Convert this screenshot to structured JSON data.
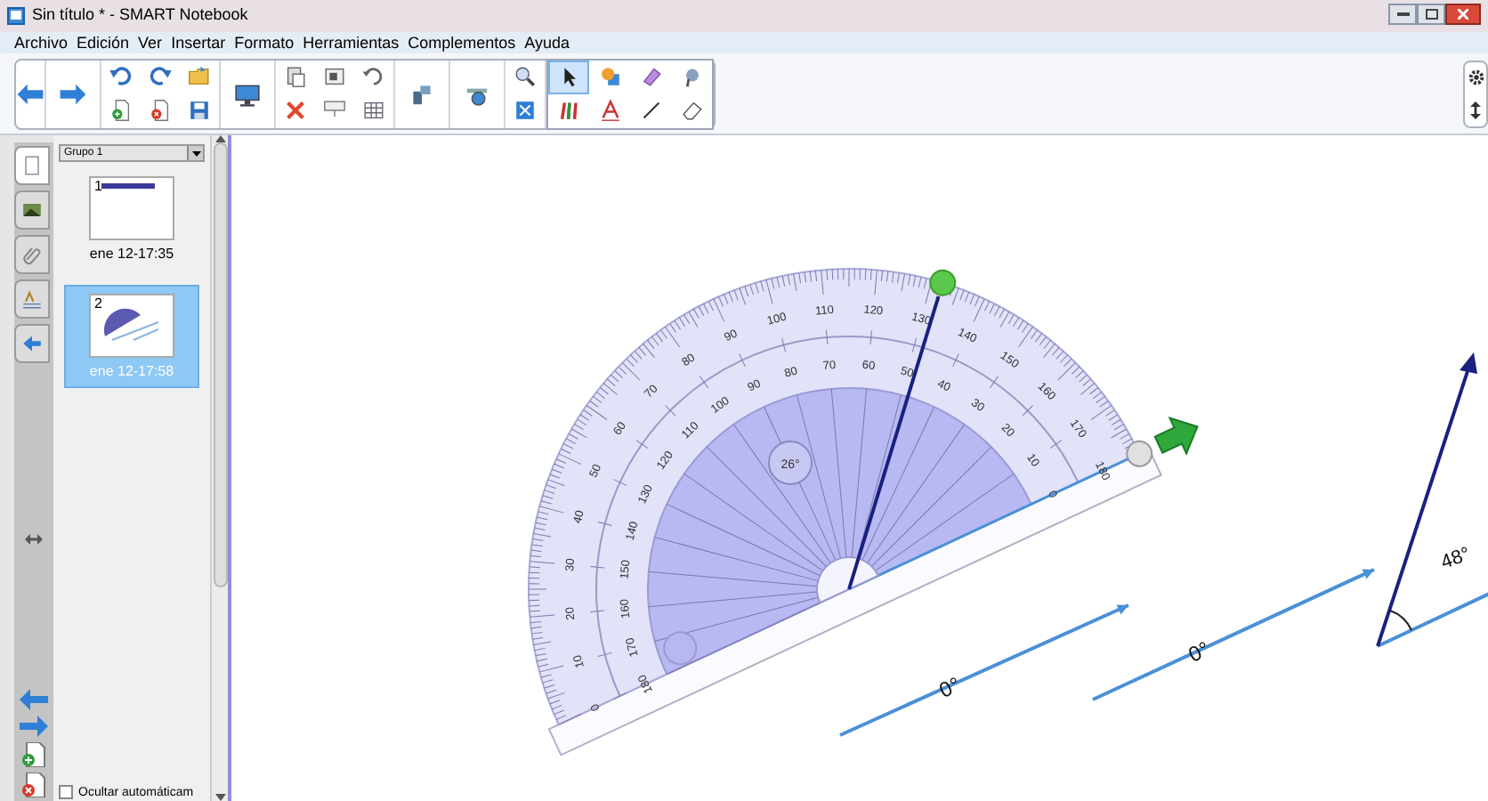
{
  "window": {
    "title": "Sin título * - SMART Notebook"
  },
  "menu": [
    "Archivo",
    "Edición",
    "Ver",
    "Insertar",
    "Formato",
    "Herramientas",
    "Complementos",
    "Ayuda"
  ],
  "tools": [
    {
      "kind": "select",
      "selected": true
    },
    {
      "kind": "shapes",
      "selected": false
    },
    {
      "kind": "highlighter",
      "selected": false
    },
    {
      "kind": "magic",
      "selected": false
    },
    {
      "kind": "pens",
      "selected": false
    },
    {
      "kind": "text",
      "selected": false
    },
    {
      "kind": "line",
      "selected": false
    },
    {
      "kind": "eraser",
      "selected": false
    }
  ],
  "side_tabs": [
    {
      "kind": "pages",
      "selected": true
    },
    {
      "kind": "gallery",
      "selected": false
    },
    {
      "kind": "attachments",
      "selected": false
    },
    {
      "kind": "properties",
      "selected": false
    },
    {
      "kind": "addons",
      "selected": false
    }
  ],
  "page_sorter": {
    "group": "Grupo 1",
    "pages": [
      {
        "number": "1",
        "time": "ene 12-17:35",
        "selected": false
      },
      {
        "number": "2",
        "time": "ene 12-17:58",
        "selected": true
      }
    ],
    "auto_hide": {
      "label": "Ocultar automáticam",
      "checked": false
    }
  },
  "protractor": {
    "outer_scale": [
      "0",
      "10",
      "20",
      "30",
      "40",
      "50",
      "60",
      "70",
      "80",
      "90",
      "100",
      "110",
      "120",
      "130",
      "140",
      "150",
      "160",
      "170",
      "180"
    ],
    "inner_scale": [
      "180",
      "170",
      "160",
      "150",
      "140",
      "130",
      "120",
      "110",
      "100",
      "90",
      "80",
      "70",
      "60",
      "50",
      "40",
      "30",
      "20",
      "10",
      "0"
    ],
    "angle_reading": "26°"
  },
  "lines": [
    {
      "label": "0°"
    },
    {
      "label": "0°"
    }
  ],
  "angle_figure": {
    "label": "48°"
  }
}
